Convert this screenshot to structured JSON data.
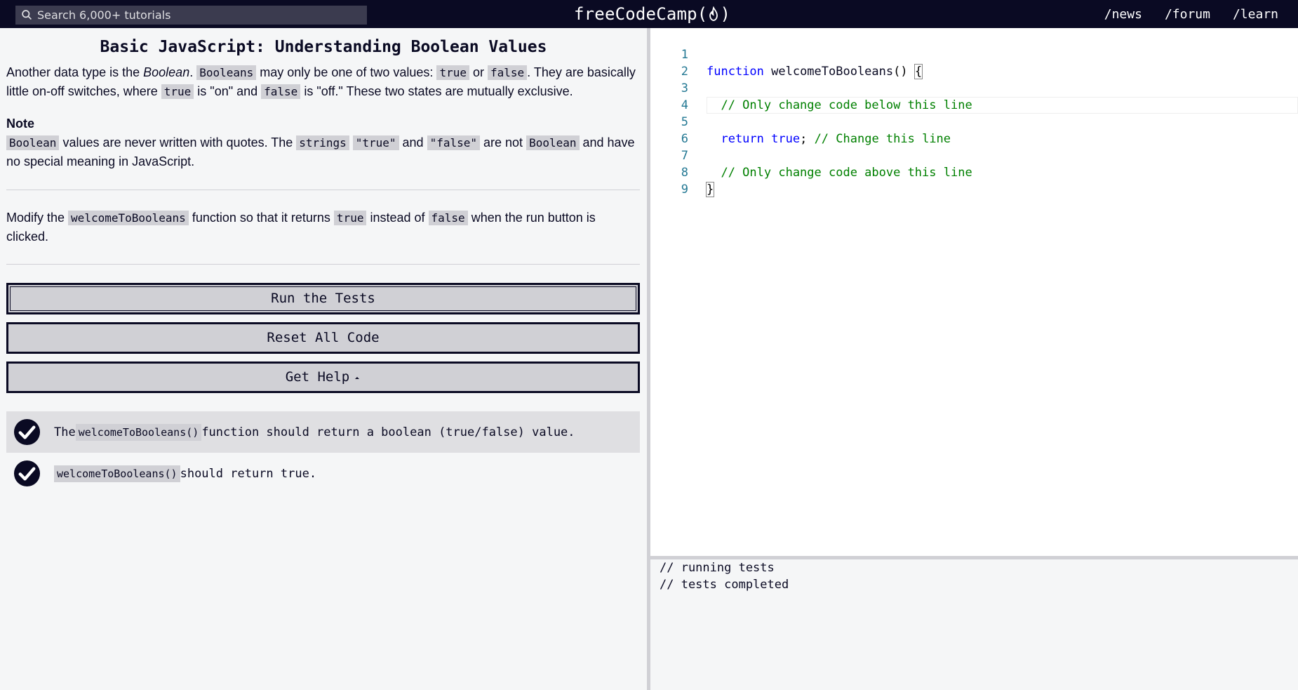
{
  "nav": {
    "search_placeholder": "Search 6,000+ tutorials",
    "logo_left": "freeCodeCamp(",
    "logo_right": ")",
    "links": [
      "/news",
      "/forum",
      "/learn"
    ]
  },
  "challenge": {
    "title": "Basic JavaScript: Understanding Boolean Values",
    "p1": {
      "t1": "Another data type is the ",
      "em": "Boolean",
      "t2": ". ",
      "c1": "Booleans",
      "t3": " may only be one of two values: ",
      "c2": "true",
      "t4": " or ",
      "c3": "false",
      "t5": ". They are basically little on-off switches, where ",
      "c4": "true",
      "t6": " is \"on\" and ",
      "c5": "false",
      "t7": " is \"off.\" These two states are mutually exclusive."
    },
    "note_heading": "Note",
    "p2": {
      "c1": "Boolean",
      "t1": " values are never written with quotes. The ",
      "c2": "strings",
      "t2": " ",
      "c3": "\"true\"",
      "t3": " and ",
      "c4": "\"false\"",
      "t4": " are not ",
      "c5": "Boolean",
      "t5": " and have no special meaning in JavaScript."
    },
    "p3": {
      "t1": "Modify the ",
      "c1": "welcomeToBooleans",
      "t2": " function so that it returns ",
      "c2": "true",
      "t3": " instead of ",
      "c3": "false",
      "t4": " when the run button is clicked."
    }
  },
  "buttons": {
    "run": "Run the Tests",
    "reset": "Reset All Code",
    "help": "Get Help"
  },
  "tests": [
    {
      "t1": "The ",
      "code": "welcomeToBooleans()",
      "t2": " function should return a boolean (true/false) value.",
      "passed": true
    },
    {
      "t1": "",
      "code": "welcomeToBooleans()",
      "t2": " should return true.",
      "passed": true
    }
  ],
  "editor": {
    "line_numbers": [
      "1",
      "2",
      "3",
      "4",
      "5",
      "6",
      "7",
      "8",
      "9"
    ],
    "l1_kw": "function",
    "l1_name": " welcomeToBooleans",
    "l1_rest": "() ",
    "l1_brace": "{",
    "l3": "  // Only change code below this line",
    "l5_kw": "  return",
    "l5_val": " true",
    "l5_semi": "; ",
    "l5_cmt": "// Change this line",
    "l7": "  // Only change code above this line",
    "l8": "}"
  },
  "console": [
    "// running tests",
    "// tests completed"
  ],
  "colors": {
    "nav_bg": "#0a0a23",
    "code_bg": "#d0d0d5",
    "keyword": "#0000ff",
    "comment": "#008000",
    "line_number": "#237893"
  }
}
